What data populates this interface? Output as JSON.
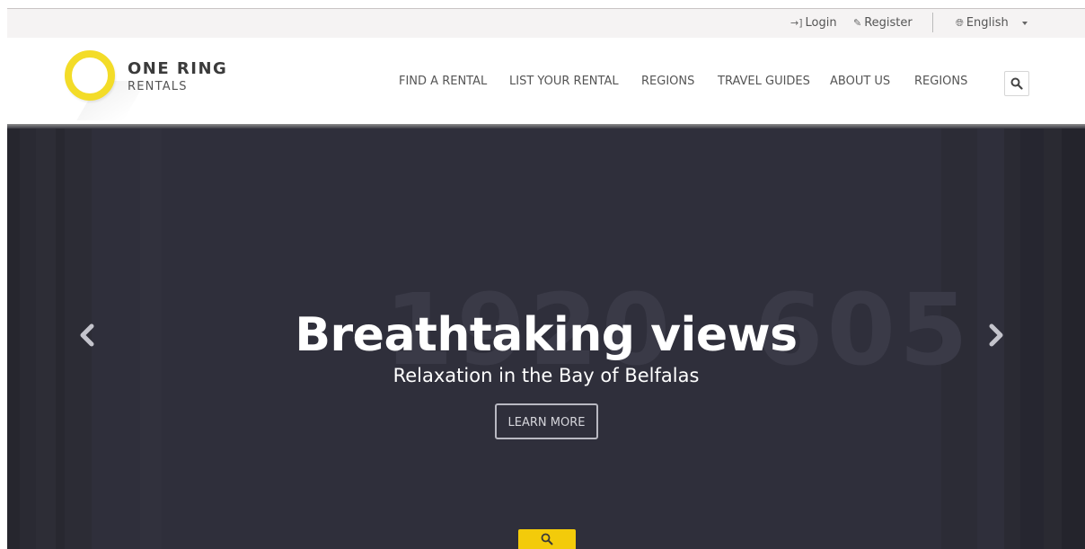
{
  "topbar": {
    "login_label": "Login",
    "register_label": "Register",
    "language_label": "English"
  },
  "brand": {
    "title": "ONE RING",
    "subtitle": "RENTALS",
    "ring_color": "#f3dc28"
  },
  "nav": {
    "items": [
      {
        "label": "FIND A RENTAL"
      },
      {
        "label": "LIST YOUR RENTAL"
      },
      {
        "label": "REGIONS"
      },
      {
        "label": "TRAVEL GUIDES"
      },
      {
        "label": "ABOUT US"
      },
      {
        "label": "REGIONS"
      }
    ]
  },
  "hero": {
    "headline": "Breathtaking views",
    "subline": "Relaxation in the Bay of Belfalas",
    "cta_label": "LEARN MORE",
    "placeholder_text_left": "1920",
    "placeholder_text_right": "605",
    "background_color": "#2f2f3b",
    "accent_color": "#f3cb0a"
  },
  "icons": {
    "login": "sign-in-icon",
    "register": "edit-icon",
    "language": "globe-icon",
    "search": "search-icon",
    "prev": "chevron-left-icon",
    "next": "chevron-right-icon"
  }
}
